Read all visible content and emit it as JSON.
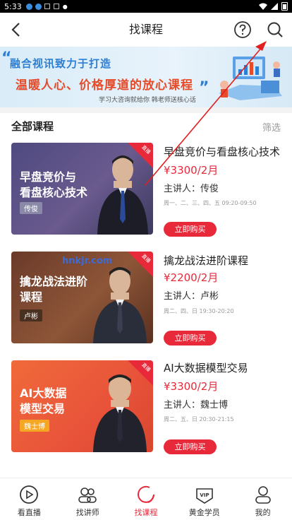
{
  "status": {
    "time": "5:33"
  },
  "header": {
    "title": "找课程",
    "back_icon": "chevron-left-icon",
    "help_icon": "question-circle-icon",
    "search_icon": "search-icon"
  },
  "banner": {
    "line1": "融合视讯致力于打造",
    "line2": "温暖人心、价格厚道的放心课程",
    "line3": "学习大咨询就给你 韩老师送核心话"
  },
  "section": {
    "title": "全部课程",
    "filter": "筛选"
  },
  "courses": [
    {
      "thumb_title_1": "早盘竞价与",
      "thumb_title_2": "看盘核心技术",
      "thumb_tag": "传俊",
      "badge": "直播",
      "title": "早盘竞价与看盘核心技术",
      "price": "¥3300/2月",
      "lecturer": "主讲人：传俊",
      "schedule": "周一、二、三、四、五 09:20-09:50",
      "buy": "立即购买"
    },
    {
      "thumb_title_1": "擒龙战法进阶",
      "thumb_title_2": "课程",
      "thumb_tag": "卢彬",
      "badge": "直播",
      "watermark": "hnkjr.com",
      "title": "擒龙战法进阶课程",
      "price": "¥2200/2月",
      "lecturer": "主讲人：卢彬",
      "schedule": "周二、四、日 19:30-20:20",
      "buy": "立即购买"
    },
    {
      "thumb_title_1": "AI大数据",
      "thumb_title_2": "模型交易",
      "thumb_tag": "魏士博",
      "badge": "直播",
      "title": "AI大数据模型交易",
      "price": "¥3300/2月",
      "lecturer": "主讲人：魏士博",
      "schedule": "周二、五、日 20:30-21:15",
      "buy": "立即购买"
    }
  ],
  "nav": [
    {
      "label": "看直播",
      "icon": "play-circle-icon"
    },
    {
      "label": "找讲师",
      "icon": "people-icon"
    },
    {
      "label": "找课程",
      "icon": "course-icon",
      "active": true
    },
    {
      "label": "黄金学员",
      "icon": "vip-icon"
    },
    {
      "label": "我的",
      "icon": "user-icon"
    }
  ],
  "colors": {
    "accent": "#e8293a",
    "banner_blue": "#2d7fd3"
  }
}
